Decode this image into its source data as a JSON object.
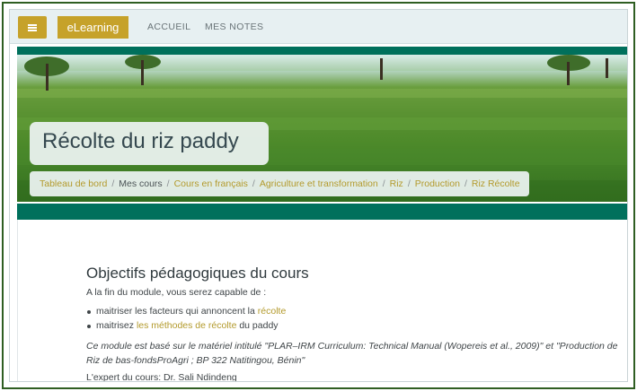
{
  "navbar": {
    "menu_icon": "hamburger-menu-icon",
    "brand": "eLearning",
    "links": [
      "ACCUEIL",
      "MES NOTES"
    ]
  },
  "hero": {
    "title": "Récolte du riz paddy"
  },
  "breadcrumb": [
    {
      "label": "Tableau de bord",
      "link": true
    },
    {
      "label": "Mes cours",
      "link": false
    },
    {
      "label": "Cours en français",
      "link": true
    },
    {
      "label": "Agriculture et transformation",
      "link": true
    },
    {
      "label": "Riz",
      "link": true
    },
    {
      "label": "Production",
      "link": true
    },
    {
      "label": "Riz Récolte",
      "link": true
    }
  ],
  "breadcrumb_separator": "/",
  "content": {
    "heading": "Objectifs pédagogiques du cours",
    "intro": "A la fin du module, vous serez capable de :",
    "goals": [
      {
        "before": "maitriser les facteurs qui annoncent la ",
        "link": "récolte",
        "after": ""
      },
      {
        "before": "maitrisez ",
        "link": "les méthodes de récolte",
        "after": " du paddy"
      }
    ],
    "note": "Ce module est basé sur le matériel intitulé \"PLAR–IRM Curriculum: Technical Manual (Wopereis et al., 2009)\" et \"Production de Riz de bas-fondsProAgri ; BP 322 Natitingou, Bénin\"",
    "expert": "L'expert du cours: Dr. Sali Ndindeng"
  },
  "colors": {
    "accent": "#c6a22a",
    "teal": "#00705c",
    "link": "#b39a2c",
    "frame": "#2f5e22"
  }
}
